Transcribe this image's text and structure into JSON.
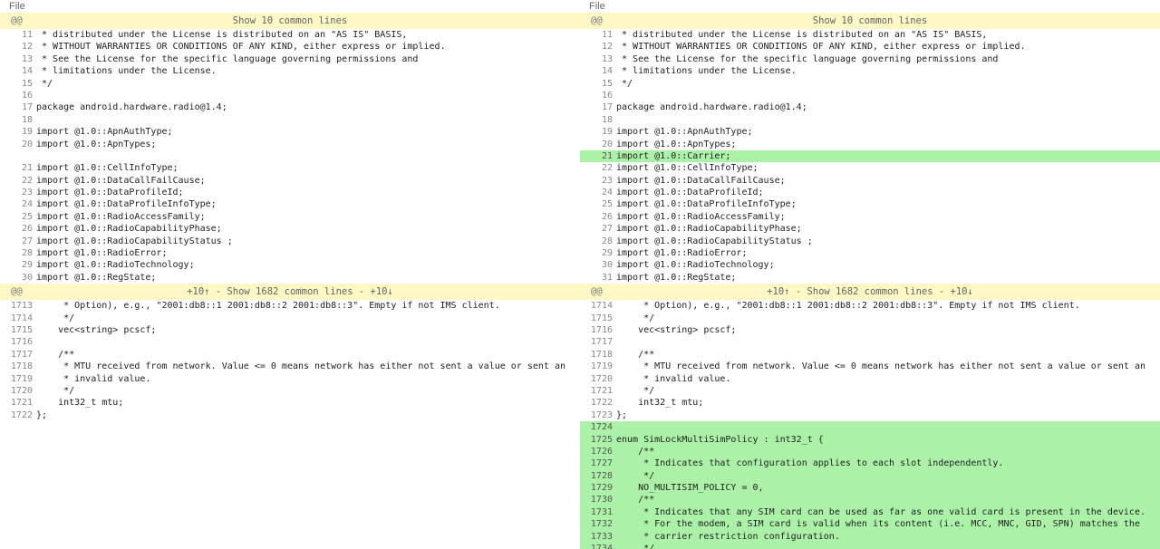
{
  "left": {
    "file_label": "File",
    "hunk1": {
      "marker": "@@",
      "label": "Show 10 common lines"
    },
    "block1": [
      {
        "n": "11",
        "t": " * distributed under the License is distributed on an \"AS IS\" BASIS,"
      },
      {
        "n": "12",
        "t": " * WITHOUT WARRANTIES OR CONDITIONS OF ANY KIND, either express or implied."
      },
      {
        "n": "13",
        "t": " * See the License for the specific language governing permissions and"
      },
      {
        "n": "14",
        "t": " * limitations under the License."
      },
      {
        "n": "15",
        "t": " */"
      },
      {
        "n": "16",
        "t": ""
      },
      {
        "n": "17",
        "t": "package android.hardware.radio@1.4;"
      },
      {
        "n": "18",
        "t": ""
      },
      {
        "n": "19",
        "t": "import @1.0::ApnAuthType;"
      },
      {
        "n": "20",
        "t": "import @1.0::ApnTypes;"
      },
      {
        "n": "",
        "t": ""
      },
      {
        "n": "21",
        "t": "import @1.0::CellInfoType;"
      },
      {
        "n": "22",
        "t": "import @1.0::DataCallFailCause;"
      },
      {
        "n": "23",
        "t": "import @1.0::DataProfileId;"
      },
      {
        "n": "24",
        "t": "import @1.0::DataProfileInfoType;"
      },
      {
        "n": "25",
        "t": "import @1.0::RadioAccessFamily;"
      },
      {
        "n": "26",
        "t": "import @1.0::RadioCapabilityPhase;"
      },
      {
        "n": "27",
        "t": "import @1.0::RadioCapabilityStatus ;"
      },
      {
        "n": "28",
        "t": "import @1.0::RadioError;"
      },
      {
        "n": "29",
        "t": "import @1.0::RadioTechnology;"
      },
      {
        "n": "30",
        "t": "import @1.0::RegState;"
      }
    ],
    "hunk2": {
      "marker": "@@",
      "label": "+10↑  -  Show 1682 common lines  -  +10↓"
    },
    "block2": [
      {
        "n": "1713",
        "t": "     * Option), e.g., \"2001:db8::1 2001:db8::2 2001:db8::3\". Empty if not IMS client."
      },
      {
        "n": "1714",
        "t": "     */"
      },
      {
        "n": "1715",
        "t": "    vec<string> pcscf;"
      },
      {
        "n": "1716",
        "t": ""
      },
      {
        "n": "1717",
        "t": "    /**"
      },
      {
        "n": "1718",
        "t": "     * MTU received from network. Value <= 0 means network has either not sent a value or sent an"
      },
      {
        "n": "1719",
        "t": "     * invalid value."
      },
      {
        "n": "1720",
        "t": "     */"
      },
      {
        "n": "1721",
        "t": "    int32_t mtu;"
      },
      {
        "n": "1722",
        "t": "};"
      }
    ]
  },
  "right": {
    "file_label": "File",
    "hunk1": {
      "marker": "@@",
      "label": "Show 10 common lines"
    },
    "block1": [
      {
        "n": "11",
        "t": " * distributed under the License is distributed on an \"AS IS\" BASIS,"
      },
      {
        "n": "12",
        "t": " * WITHOUT WARRANTIES OR CONDITIONS OF ANY KIND, either express or implied."
      },
      {
        "n": "13",
        "t": " * See the License for the specific language governing permissions and"
      },
      {
        "n": "14",
        "t": " * limitations under the License."
      },
      {
        "n": "15",
        "t": " */"
      },
      {
        "n": "16",
        "t": ""
      },
      {
        "n": "17",
        "t": "package android.hardware.radio@1.4;"
      },
      {
        "n": "18",
        "t": ""
      },
      {
        "n": "19",
        "t": "import @1.0::ApnAuthType;"
      },
      {
        "n": "20",
        "t": "import @1.0::ApnTypes;"
      },
      {
        "n": "21",
        "t": "import @1.0::Carrier;",
        "added": true
      },
      {
        "n": "22",
        "t": "import @1.0::CellInfoType;"
      },
      {
        "n": "23",
        "t": "import @1.0::DataCallFailCause;"
      },
      {
        "n": "24",
        "t": "import @1.0::DataProfileId;"
      },
      {
        "n": "25",
        "t": "import @1.0::DataProfileInfoType;"
      },
      {
        "n": "26",
        "t": "import @1.0::RadioAccessFamily;"
      },
      {
        "n": "27",
        "t": "import @1.0::RadioCapabilityPhase;"
      },
      {
        "n": "28",
        "t": "import @1.0::RadioCapabilityStatus ;"
      },
      {
        "n": "29",
        "t": "import @1.0::RadioError;"
      },
      {
        "n": "30",
        "t": "import @1.0::RadioTechnology;"
      },
      {
        "n": "31",
        "t": "import @1.0::RegState;"
      }
    ],
    "hunk2": {
      "marker": "@@",
      "label": "+10↑  -  Show 1682 common lines  -  +10↓"
    },
    "block2": [
      {
        "n": "1714",
        "t": "     * Option), e.g., \"2001:db8::1 2001:db8::2 2001:db8::3\". Empty if not IMS client."
      },
      {
        "n": "1715",
        "t": "     */"
      },
      {
        "n": "1716",
        "t": "    vec<string> pcscf;"
      },
      {
        "n": "1717",
        "t": ""
      },
      {
        "n": "1718",
        "t": "    /**"
      },
      {
        "n": "1719",
        "t": "     * MTU received from network. Value <= 0 means network has either not sent a value or sent an"
      },
      {
        "n": "1720",
        "t": "     * invalid value."
      },
      {
        "n": "1721",
        "t": "     */"
      },
      {
        "n": "1722",
        "t": "    int32_t mtu;"
      },
      {
        "n": "1723",
        "t": "};"
      },
      {
        "n": "1724",
        "t": "",
        "added": true
      },
      {
        "n": "1725",
        "t": "enum SimLockMultiSimPolicy : int32_t {",
        "added": true
      },
      {
        "n": "1726",
        "t": "    /**",
        "added": true
      },
      {
        "n": "1727",
        "t": "     * Indicates that configuration applies to each slot independently.",
        "added": true
      },
      {
        "n": "1728",
        "t": "     */",
        "added": true
      },
      {
        "n": "1729",
        "t": "    NO_MULTISIM_POLICY = 0,",
        "added": true
      },
      {
        "n": "1730",
        "t": "    /**",
        "added": true
      },
      {
        "n": "1731",
        "t": "     * Indicates that any SIM card can be used as far as one valid card is present in the device.",
        "added": true
      },
      {
        "n": "1732",
        "t": "     * For the modem, a SIM card is valid when its content (i.e. MCC, MNC, GID, SPN) matches the",
        "added": true
      },
      {
        "n": "1733",
        "t": "     * carrier restriction configuration.",
        "added": true
      },
      {
        "n": "1734",
        "t": "     */",
        "added": true
      }
    ]
  },
  "colors": {
    "hunk_bg": "#fff8c5",
    "added_bg": "#abf2a8"
  }
}
